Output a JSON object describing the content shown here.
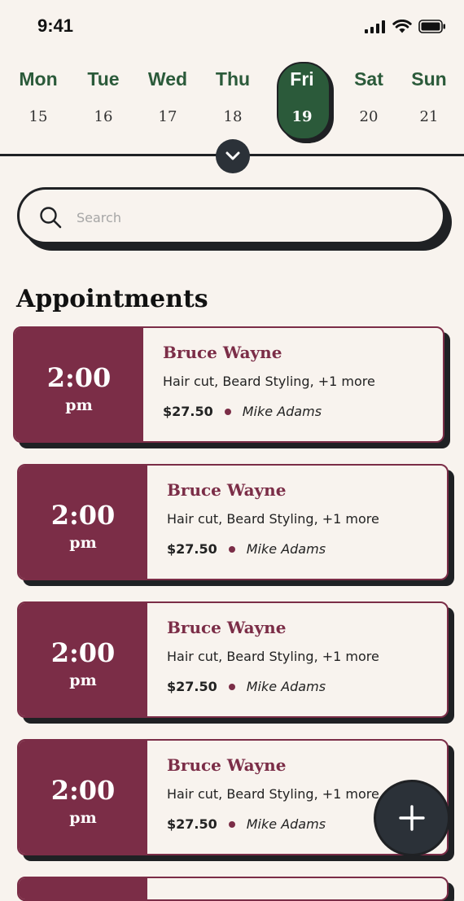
{
  "status_bar": {
    "time": "9:41"
  },
  "week": {
    "days": [
      {
        "name": "Mon",
        "date": "15",
        "active": false
      },
      {
        "name": "Tue",
        "date": "16",
        "active": false
      },
      {
        "name": "Wed",
        "date": "17",
        "active": false
      },
      {
        "name": "Thu",
        "date": "18",
        "active": false
      },
      {
        "name": "Fri",
        "date": "19",
        "active": true
      },
      {
        "name": "Sat",
        "date": "20",
        "active": false
      },
      {
        "name": "Sun",
        "date": "21",
        "active": false
      }
    ]
  },
  "search": {
    "placeholder": "Search",
    "value": ""
  },
  "appointments": {
    "title": "Appointments",
    "items": [
      {
        "time": "2:00",
        "ampm": "pm",
        "client": "Bruce Wayne",
        "services": "Hair cut, Beard Styling, +1 more",
        "price": "$27.50",
        "barber": "Mike Adams"
      },
      {
        "time": "2:00",
        "ampm": "pm",
        "client": "Bruce Wayne",
        "services": "Hair cut, Beard Styling, +1 more",
        "price": "$27.50",
        "barber": "Mike Adams"
      },
      {
        "time": "2:00",
        "ampm": "pm",
        "client": "Bruce Wayne",
        "services": "Hair cut, Beard Styling, +1 more",
        "price": "$27.50",
        "barber": "Mike Adams"
      },
      {
        "time": "2:00",
        "ampm": "pm",
        "client": "Bruce Wayne",
        "services": "Hair cut, Beard Styling, +1 more",
        "price": "$27.50",
        "barber": "Mike Adams"
      }
    ]
  },
  "colors": {
    "accent": "#7b2d47",
    "green": "#2b5a3a",
    "dark": "#2b3138",
    "background": "#f8f3ee"
  },
  "icons": {
    "signal": "cellular-signal-icon",
    "wifi": "wifi-icon",
    "battery": "battery-icon",
    "search": "search-icon",
    "expand": "chevron-down-icon",
    "add": "plus-icon"
  }
}
